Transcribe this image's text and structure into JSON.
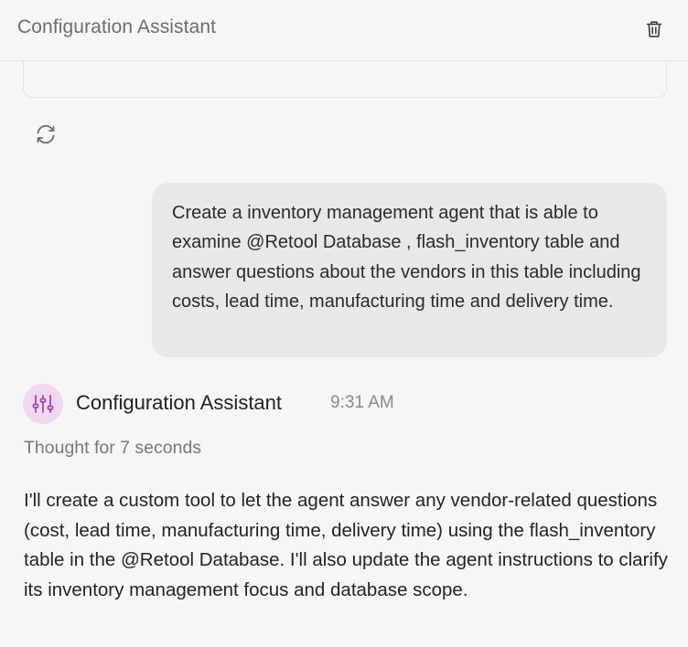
{
  "header": {
    "title": "Configuration Assistant",
    "delete_icon": "trash-icon"
  },
  "controls": {
    "regenerate_icon": "refresh-icon"
  },
  "user_message": {
    "text": "Create a inventory management agent that is able to examine @Retool Database , flash_inventory table and answer questions about the vendors in this table including costs, lead time, manufacturing time and delivery time."
  },
  "assistant_message": {
    "avatar_icon": "sliders-icon",
    "name": "Configuration Assistant",
    "time": "9:31 AM",
    "thought": "Thought for 7 seconds",
    "text": "I'll create a custom tool to let the agent answer any vendor-related questions (cost, lead time, manufacturing time, delivery time) using the flash_inventory table in the @Retool Database. I'll also update the agent instructions to clarify its inventory management focus and database scope."
  },
  "colors": {
    "background": "#f6f6f6",
    "user_bubble": "#e8e8e8",
    "avatar_bg": "#f2d7f1",
    "avatar_fg": "#a64aa4"
  }
}
